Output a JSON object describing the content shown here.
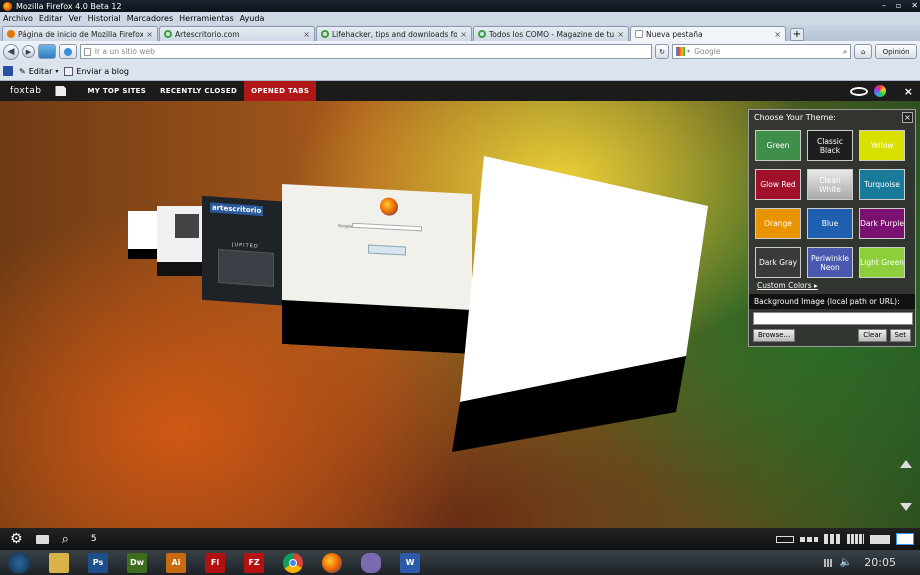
{
  "window": {
    "title": "Mozilla Firefox 4.0 Beta 12"
  },
  "menu": [
    "Archivo",
    "Editar",
    "Ver",
    "Historial",
    "Marcadores",
    "Herramientas",
    "Ayuda"
  ],
  "tabs": [
    {
      "label": "Página de inicio de Mozilla Firefox",
      "icon_color": "#e8750a"
    },
    {
      "label": "Artescritorio.com",
      "icon_color": "#3aa03a"
    },
    {
      "label": "Lifehacker, tips and downloads for g...",
      "icon_color": "#3aa03a"
    },
    {
      "label": "Todos los COMO - Magazine de tuto...",
      "icon_color": "#3aa03a"
    },
    {
      "label": "Nueva pestaña",
      "icon_color": "#ffffff"
    }
  ],
  "navbar": {
    "url_placeholder": "Ir a un sitio web",
    "search_placeholder": "Google",
    "options_label": "Opinión"
  },
  "bookmarks": {
    "edit_label": "Editar",
    "send_label": "Enviar a blog"
  },
  "foxtab": {
    "logo": "foxtab",
    "links": [
      "MY TOP SITES",
      "RECENTLY CLOSED",
      "OPENED TABS"
    ],
    "active_link": "OPENED TABS"
  },
  "thumbnails": {
    "artescritorio_label": "artescritorio",
    "jupited_label": "JUPITED",
    "google_label": "Google"
  },
  "theme_panel": {
    "title": "Choose Your Theme:",
    "themes": [
      {
        "label": "Green",
        "color": "#3f8f4a"
      },
      {
        "label": "Classic Black",
        "color": "#1e1e1e"
      },
      {
        "label": "Yellow",
        "color": "#d8e000"
      },
      {
        "label": "Glow Red",
        "color": "#a0102a"
      },
      {
        "label": "Clean White",
        "color": "#c9c9c9"
      },
      {
        "label": "Turquoise",
        "color": "#1a7a9a"
      },
      {
        "label": "Orange",
        "color": "#e89400"
      },
      {
        "label": "Blue",
        "color": "#1e5fb0"
      },
      {
        "label": "Dark Purple",
        "color": "#7a1070"
      },
      {
        "label": "Dark Gray",
        "color": "#3a3a3a"
      },
      {
        "label": "Periwinkle Neon",
        "color": "#4a58b0"
      },
      {
        "label": "Light Green",
        "color": "#8ccf3a"
      }
    ],
    "custom_colors": "Custom Colors",
    "bg_label": "Background Image (local path or URL):",
    "browse": "Browse...",
    "clear": "Clear",
    "set": "Set"
  },
  "bottombar": {
    "count": "5"
  },
  "taskbar": {
    "apps": [
      {
        "name": "Explorer",
        "label": "",
        "color": "#d9b24a"
      },
      {
        "name": "Photoshop",
        "label": "Ps",
        "color": "#1d4f8c"
      },
      {
        "name": "Dreamweaver",
        "label": "Dw",
        "color": "#3d6e1e"
      },
      {
        "name": "Illustrator",
        "label": "Ai",
        "color": "#c96a10"
      },
      {
        "name": "Flash",
        "label": "Fl",
        "color": "#b01010"
      },
      {
        "name": "FileZilla",
        "label": "FZ",
        "color": "#b51212"
      },
      {
        "name": "Chrome",
        "label": "",
        "color": "#d4a82a"
      },
      {
        "name": "Firefox",
        "label": "",
        "color": "#e8750a"
      },
      {
        "name": "Pidgin",
        "label": "",
        "color": "#7a6ab0"
      },
      {
        "name": "Word",
        "label": "W",
        "color": "#2a5aa8"
      }
    ],
    "clock": "20:05"
  }
}
